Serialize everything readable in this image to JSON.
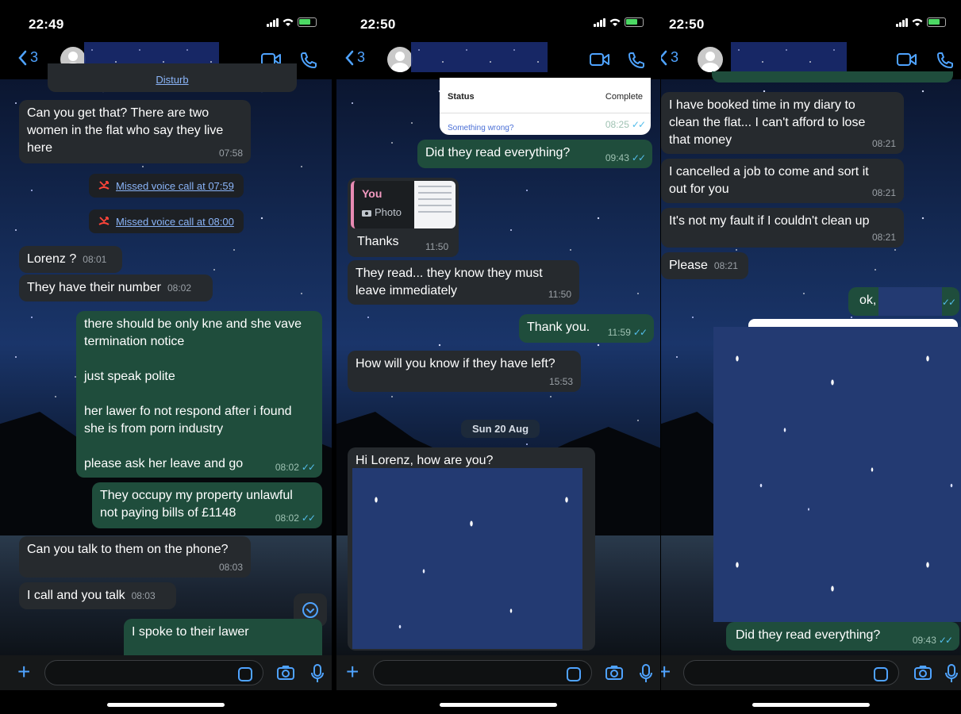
{
  "colors": {
    "accent": "#4fa3ff",
    "incoming": "#262a2e",
    "outgoing": "#1f4d3c",
    "missed_call": "#ff453a",
    "read_ticks": "#53bdeb"
  },
  "screens": [
    {
      "status_time": "22:49",
      "back_count": "3",
      "messages": {
        "m1_text": "Can you get that? There are two\nwomen in the flat who say they live\nhere",
        "m1_time": "07:58",
        "call1": "Missed voice call at 07:59",
        "call2": "Missed voice call at 08:00",
        "m2_text": "Lorenz ?",
        "m2_time": "08:01",
        "m3_text": "They have their number",
        "m3_time": "08:02",
        "m4_p1": "there should be only kne and she vave\ntermination notice",
        "m4_p2": "just speak polite",
        "m4_p3": "her lawer fo not respond after i found\nshe is from porn industry",
        "m4_p4": "please ask her leave and go",
        "m4_time": "08:02",
        "m5_text": "They occupy my property unlawful\nnot paying bills of £1148",
        "m5_time": "08:02",
        "m6_text": "Can you talk to them on the phone?",
        "m6_time": "08:03",
        "m7_text": "I call and you talk",
        "m7_time": "08:03",
        "m8_text": "I spoke to their lawer",
        "top_partial": "Disturb"
      }
    },
    {
      "status_time": "22:50",
      "back_count": "3",
      "messages": {
        "card_status_label": "Status",
        "card_status_value": "Complete",
        "card_footer": "Something wrong?",
        "card_time": "08:25",
        "m1_text": "Did they read everything?",
        "m1_time": "09:43",
        "reply_who": "You",
        "reply_kind": "Photo",
        "m2_text": "Thanks",
        "m2_time": "11:50",
        "m3_text": "They read... they know they must\nleave immediately",
        "m3_time": "11:50",
        "m4_text": "Thank you.",
        "m4_time": "11:59",
        "m5_text": "How will you know if they have left?",
        "m5_time": "15:53",
        "date_chip": "Sun 20 Aug",
        "m6_text": "Hi Lorenz, how are you?\nI'm going on holiday"
      }
    },
    {
      "status_time": "22:50",
      "back_count": "3",
      "messages": {
        "m1_text": "I have booked time in my diary to\nclean the flat... I can't afford to lose\nthat money",
        "m1_time": "08:21",
        "m2_text": "I cancelled a job to come and sort it\nout for you",
        "m2_time": "08:21",
        "m3_text": "It's not my fault if I couldn't clean up",
        "m3_time": "08:21",
        "m4_text": "Please",
        "m4_time": "08:21",
        "m5_text": "ok,",
        "m6_text": "Did they read everything?",
        "m6_time": "09:43"
      }
    }
  ]
}
